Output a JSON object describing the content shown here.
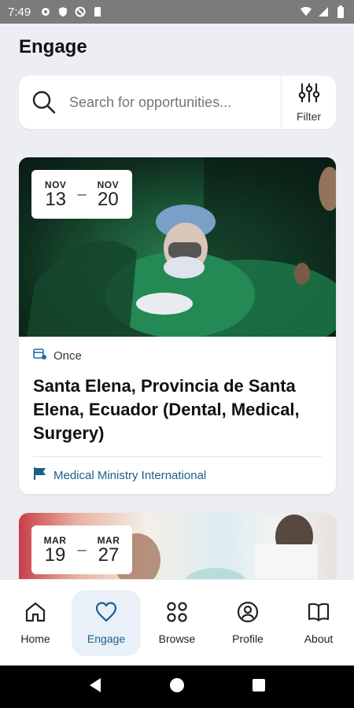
{
  "status_bar": {
    "time": "7:49"
  },
  "header": {
    "title": "Engage"
  },
  "search": {
    "placeholder": "Search for opportunities...",
    "filter_label": "Filter"
  },
  "opportunities": [
    {
      "start_month": "NOV",
      "start_day": "13",
      "end_month": "NOV",
      "end_day": "20",
      "frequency": "Once",
      "title": "Santa Elena, Provincia de Santa Elena, Ecuador (Dental, Medical, Surgery)",
      "organization": "Medical Ministry International"
    },
    {
      "start_month": "MAR",
      "start_day": "19",
      "end_month": "MAR",
      "end_day": "27"
    }
  ],
  "bottom_nav": {
    "items": [
      {
        "label": "Home",
        "icon": "home-icon"
      },
      {
        "label": "Engage",
        "icon": "heart-icon",
        "active": true
      },
      {
        "label": "Browse",
        "icon": "grid-icon"
      },
      {
        "label": "Profile",
        "icon": "profile-icon"
      },
      {
        "label": "About",
        "icon": "book-icon"
      }
    ]
  },
  "colors": {
    "accent": "#1b5f8a",
    "background": "#eceef3",
    "nav_active_bg": "#e9f0f8"
  }
}
